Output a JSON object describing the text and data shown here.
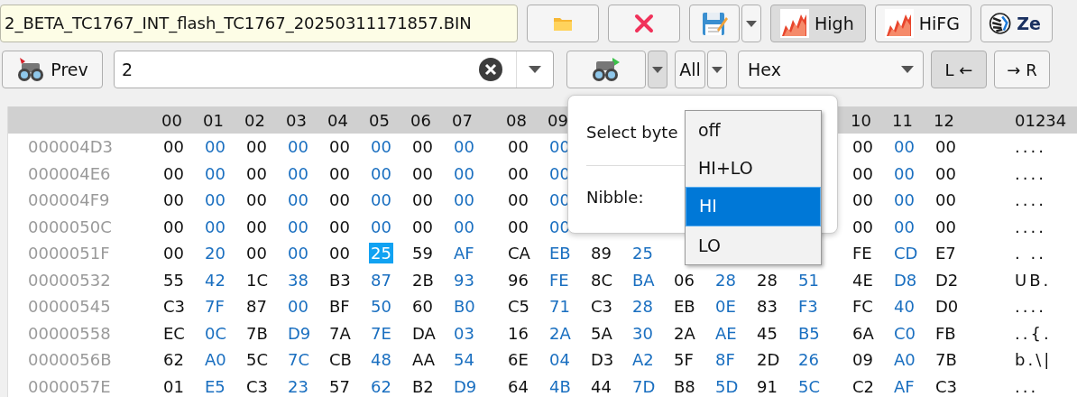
{
  "toolbar_top": {
    "file_name": "2_BETA_TC1767_INT_flash_TC1767_20250311171857.BIN",
    "toggles": [
      {
        "kind": "flame",
        "label": "High",
        "pressed": true
      },
      {
        "kind": "flame",
        "label": "HiFG",
        "pressed": false
      },
      {
        "kind": "zebra",
        "label": "Ze",
        "pressed": false
      }
    ]
  },
  "toolbar_find": {
    "prev_label": "Prev",
    "search": {
      "value": "2"
    },
    "next_menu_pressed": true,
    "scope": "All",
    "format": "Hex",
    "direction": [
      {
        "label": "L ←",
        "selected": true
      },
      {
        "label": "→ R",
        "selected": false
      }
    ]
  },
  "hex_view": {
    "columns": [
      "00",
      "01",
      "02",
      "03",
      "04",
      "05",
      "06",
      "07",
      "08",
      "09"
    ],
    "columns_end": [
      "10",
      "11",
      "12"
    ],
    "ascii_header": "01234",
    "rows": [
      {
        "address": "000004D3",
        "bytes": [
          {
            "value": "00",
            "selected": false
          },
          {
            "value": "00",
            "selected": false
          },
          {
            "value": "00",
            "selected": false
          },
          {
            "value": "00",
            "selected": false
          },
          {
            "value": "00",
            "selected": false
          },
          {
            "value": "00",
            "selected": false
          },
          {
            "value": "00",
            "selected": false
          },
          {
            "value": "00",
            "selected": false
          },
          {
            "value": "00",
            "selected": false
          },
          {
            "value": "00",
            "selected": false
          }
        ],
        "bytes_end": [
          "00",
          "00",
          "00"
        ],
        "ascii": "...."
      },
      {
        "address": "000004E6",
        "bytes": [
          {
            "value": "00",
            "selected": false
          },
          {
            "value": "00",
            "selected": false
          },
          {
            "value": "00",
            "selected": false
          },
          {
            "value": "00",
            "selected": false
          },
          {
            "value": "00",
            "selected": false
          },
          {
            "value": "00",
            "selected": false
          },
          {
            "value": "00",
            "selected": false
          },
          {
            "value": "00",
            "selected": false
          },
          {
            "value": "00",
            "selected": false
          },
          {
            "value": "00",
            "selected": false
          }
        ],
        "bytes_end": [
          "00",
          "00",
          "00"
        ],
        "ascii": "...."
      },
      {
        "address": "000004F9",
        "bytes": [
          {
            "value": "00",
            "selected": false
          },
          {
            "value": "00",
            "selected": false
          },
          {
            "value": "00",
            "selected": false
          },
          {
            "value": "00",
            "selected": false
          },
          {
            "value": "00",
            "selected": false
          },
          {
            "value": "00",
            "selected": false
          },
          {
            "value": "00",
            "selected": false
          },
          {
            "value": "00",
            "selected": false
          },
          {
            "value": "00",
            "selected": false
          },
          {
            "value": "00",
            "selected": false
          }
        ],
        "bytes_end": [
          "00",
          "00",
          "00"
        ],
        "ascii": "...."
      },
      {
        "address": "0000050C",
        "bytes": [
          {
            "value": "00",
            "selected": false
          },
          {
            "value": "00",
            "selected": false
          },
          {
            "value": "00",
            "selected": false
          },
          {
            "value": "00",
            "selected": false
          },
          {
            "value": "00",
            "selected": false
          },
          {
            "value": "00",
            "selected": false
          },
          {
            "value": "00",
            "selected": false
          },
          {
            "value": "00",
            "selected": false
          },
          {
            "value": "00",
            "selected": false
          },
          {
            "value": "00",
            "selected": false
          }
        ],
        "bytes_end": [
          "00",
          "00",
          "00"
        ],
        "ascii": "...."
      },
      {
        "address": "0000051F",
        "bytes": [
          {
            "value": "00",
            "selected": false
          },
          {
            "value": "20",
            "selected": false
          },
          {
            "value": "00",
            "selected": false
          },
          {
            "value": "00",
            "selected": false
          },
          {
            "value": "00",
            "selected": false
          },
          {
            "value": "25",
            "selected": true
          },
          {
            "value": "59",
            "selected": false
          },
          {
            "value": "AF",
            "selected": false
          },
          {
            "value": "CA",
            "selected": false
          },
          {
            "value": "EB",
            "selected": false
          },
          {
            "value": "89",
            "selected": false
          },
          {
            "value": "25",
            "selected": false
          }
        ],
        "bytes_end": [
          "FE",
          "CD",
          "E7"
        ],
        "ascii": ". .."
      },
      {
        "address": "00000532",
        "bytes": [
          {
            "value": "55",
            "selected": false
          },
          {
            "value": "42",
            "selected": false
          },
          {
            "value": "1C",
            "selected": false
          },
          {
            "value": "38",
            "selected": false
          },
          {
            "value": "B3",
            "selected": false
          },
          {
            "value": "87",
            "selected": false
          },
          {
            "value": "2B",
            "selected": false
          },
          {
            "value": "93",
            "selected": false
          },
          {
            "value": "96",
            "selected": false
          },
          {
            "value": "FE",
            "selected": false
          },
          {
            "value": "8C",
            "selected": false
          },
          {
            "value": "BA",
            "selected": false
          },
          {
            "value": "06",
            "selected": false
          },
          {
            "value": "28",
            "selected": false
          },
          {
            "value": "28",
            "selected": false
          },
          {
            "value": "51",
            "selected": false
          }
        ],
        "bytes_end": [
          "4E",
          "D8",
          "D2"
        ],
        "ascii": "UB."
      },
      {
        "address": "00000545",
        "bytes": [
          {
            "value": "C3",
            "selected": false
          },
          {
            "value": "7F",
            "selected": false
          },
          {
            "value": "87",
            "selected": false
          },
          {
            "value": "00",
            "selected": false
          },
          {
            "value": "BF",
            "selected": false
          },
          {
            "value": "50",
            "selected": false
          },
          {
            "value": "60",
            "selected": false
          },
          {
            "value": "B0",
            "selected": false
          },
          {
            "value": "C5",
            "selected": false
          },
          {
            "value": "71",
            "selected": false
          },
          {
            "value": "C3",
            "selected": false
          },
          {
            "value": "28",
            "selected": false
          },
          {
            "value": "EB",
            "selected": false
          },
          {
            "value": "0E",
            "selected": false
          },
          {
            "value": "83",
            "selected": false
          },
          {
            "value": "F3",
            "selected": false
          }
        ],
        "bytes_end": [
          "FC",
          "40",
          "D0"
        ],
        "ascii": "...."
      },
      {
        "address": "00000558",
        "bytes": [
          {
            "value": "EC",
            "selected": false
          },
          {
            "value": "0C",
            "selected": false
          },
          {
            "value": "7B",
            "selected": false
          },
          {
            "value": "D9",
            "selected": false
          },
          {
            "value": "7A",
            "selected": false
          },
          {
            "value": "7E",
            "selected": false
          },
          {
            "value": "DA",
            "selected": false
          },
          {
            "value": "03",
            "selected": false
          },
          {
            "value": "16",
            "selected": false
          },
          {
            "value": "2A",
            "selected": false
          },
          {
            "value": "5A",
            "selected": false
          },
          {
            "value": "30",
            "selected": false
          },
          {
            "value": "2A",
            "selected": false
          },
          {
            "value": "AE",
            "selected": false
          },
          {
            "value": "45",
            "selected": false
          },
          {
            "value": "B5",
            "selected": false
          }
        ],
        "bytes_end": [
          "6A",
          "C0",
          "FB"
        ],
        "ascii": "..{."
      },
      {
        "address": "0000056B",
        "bytes": [
          {
            "value": "62",
            "selected": false
          },
          {
            "value": "A0",
            "selected": false
          },
          {
            "value": "5C",
            "selected": false
          },
          {
            "value": "7C",
            "selected": false
          },
          {
            "value": "CB",
            "selected": false
          },
          {
            "value": "48",
            "selected": false
          },
          {
            "value": "AA",
            "selected": false
          },
          {
            "value": "54",
            "selected": false
          },
          {
            "value": "6E",
            "selected": false
          },
          {
            "value": "04",
            "selected": false
          },
          {
            "value": "D3",
            "selected": false
          },
          {
            "value": "A2",
            "selected": false
          },
          {
            "value": "5F",
            "selected": false
          },
          {
            "value": "8F",
            "selected": false
          },
          {
            "value": "2D",
            "selected": false
          },
          {
            "value": "26",
            "selected": false
          }
        ],
        "bytes_end": [
          "09",
          "A0",
          "7B"
        ],
        "ascii": "b.\\|"
      },
      {
        "address": "0000057E",
        "bytes": [
          {
            "value": "01",
            "selected": false
          },
          {
            "value": "E5",
            "selected": false
          },
          {
            "value": "C3",
            "selected": false
          },
          {
            "value": "23",
            "selected": false
          },
          {
            "value": "57",
            "selected": false
          },
          {
            "value": "62",
            "selected": false
          },
          {
            "value": "B2",
            "selected": false
          },
          {
            "value": "D9",
            "selected": false
          },
          {
            "value": "64",
            "selected": false
          },
          {
            "value": "4B",
            "selected": false
          },
          {
            "value": "44",
            "selected": false
          },
          {
            "value": "7D",
            "selected": false
          },
          {
            "value": "B8",
            "selected": false
          },
          {
            "value": "5D",
            "selected": false
          },
          {
            "value": "91",
            "selected": false
          },
          {
            "value": "5C",
            "selected": false
          }
        ],
        "bytes_end": [
          "C2",
          "AF",
          "C3"
        ],
        "ascii": "..."
      }
    ]
  },
  "select_popup": {
    "label": "Select byte",
    "nibble_label": "Nibble:",
    "options": [
      {
        "label": "off",
        "selected": false
      },
      {
        "label": "HI+LO",
        "selected": false
      },
      {
        "label": "HI",
        "selected": true
      },
      {
        "label": "LO",
        "selected": false
      }
    ]
  }
}
